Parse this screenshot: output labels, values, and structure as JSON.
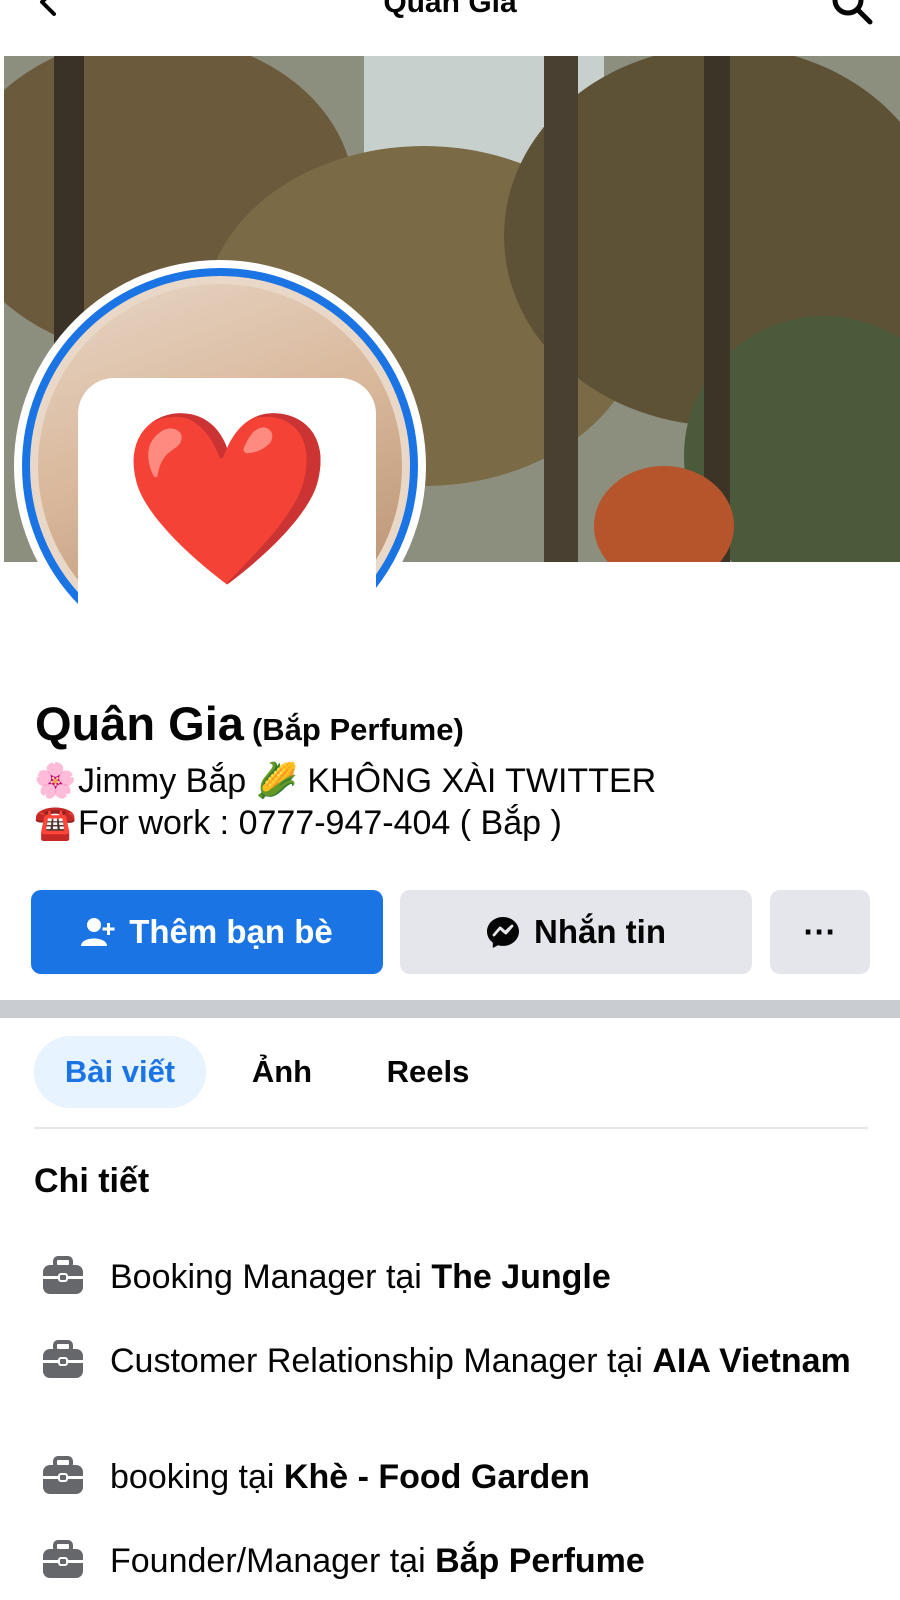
{
  "header": {
    "title": "Quân Gia",
    "back_icon": "chevron-left-icon",
    "search_icon": "search-icon"
  },
  "profile": {
    "name": "Quân Gia",
    "alt_name": "(Bắp Perfume)",
    "bio_line1_emoji": "🌸",
    "bio_line1_text": "Jimmy Bắp 🌽 KHÔNG XÀI TWITTER",
    "bio_line2_emoji": "☎️",
    "bio_line2_text": "For work :  0777-947-404 ( Bắp )",
    "avatar_emoji": "❤️"
  },
  "actions": {
    "add_friend": "Thêm bạn bè",
    "message": "Nhắn tin",
    "more": "···"
  },
  "tabs": [
    {
      "label": "Bài viết",
      "active": true
    },
    {
      "label": "Ảnh",
      "active": false
    },
    {
      "label": "Reels",
      "active": false
    }
  ],
  "details": {
    "title": "Chi tiết",
    "items": [
      {
        "role": "Booking Manager tại ",
        "org": "The Jungle"
      },
      {
        "role": "Customer Relationship Manager tại ",
        "org": "AIA Vietnam"
      },
      {
        "role": "booking tại ",
        "org": "Khè - Food Garden"
      },
      {
        "role": "Founder/Manager tại ",
        "org": "Bắp Perfume"
      }
    ]
  },
  "colors": {
    "accent": "#1b74e4",
    "button_gray": "#e4e6eb",
    "tab_active_bg": "#e7f3ff"
  }
}
